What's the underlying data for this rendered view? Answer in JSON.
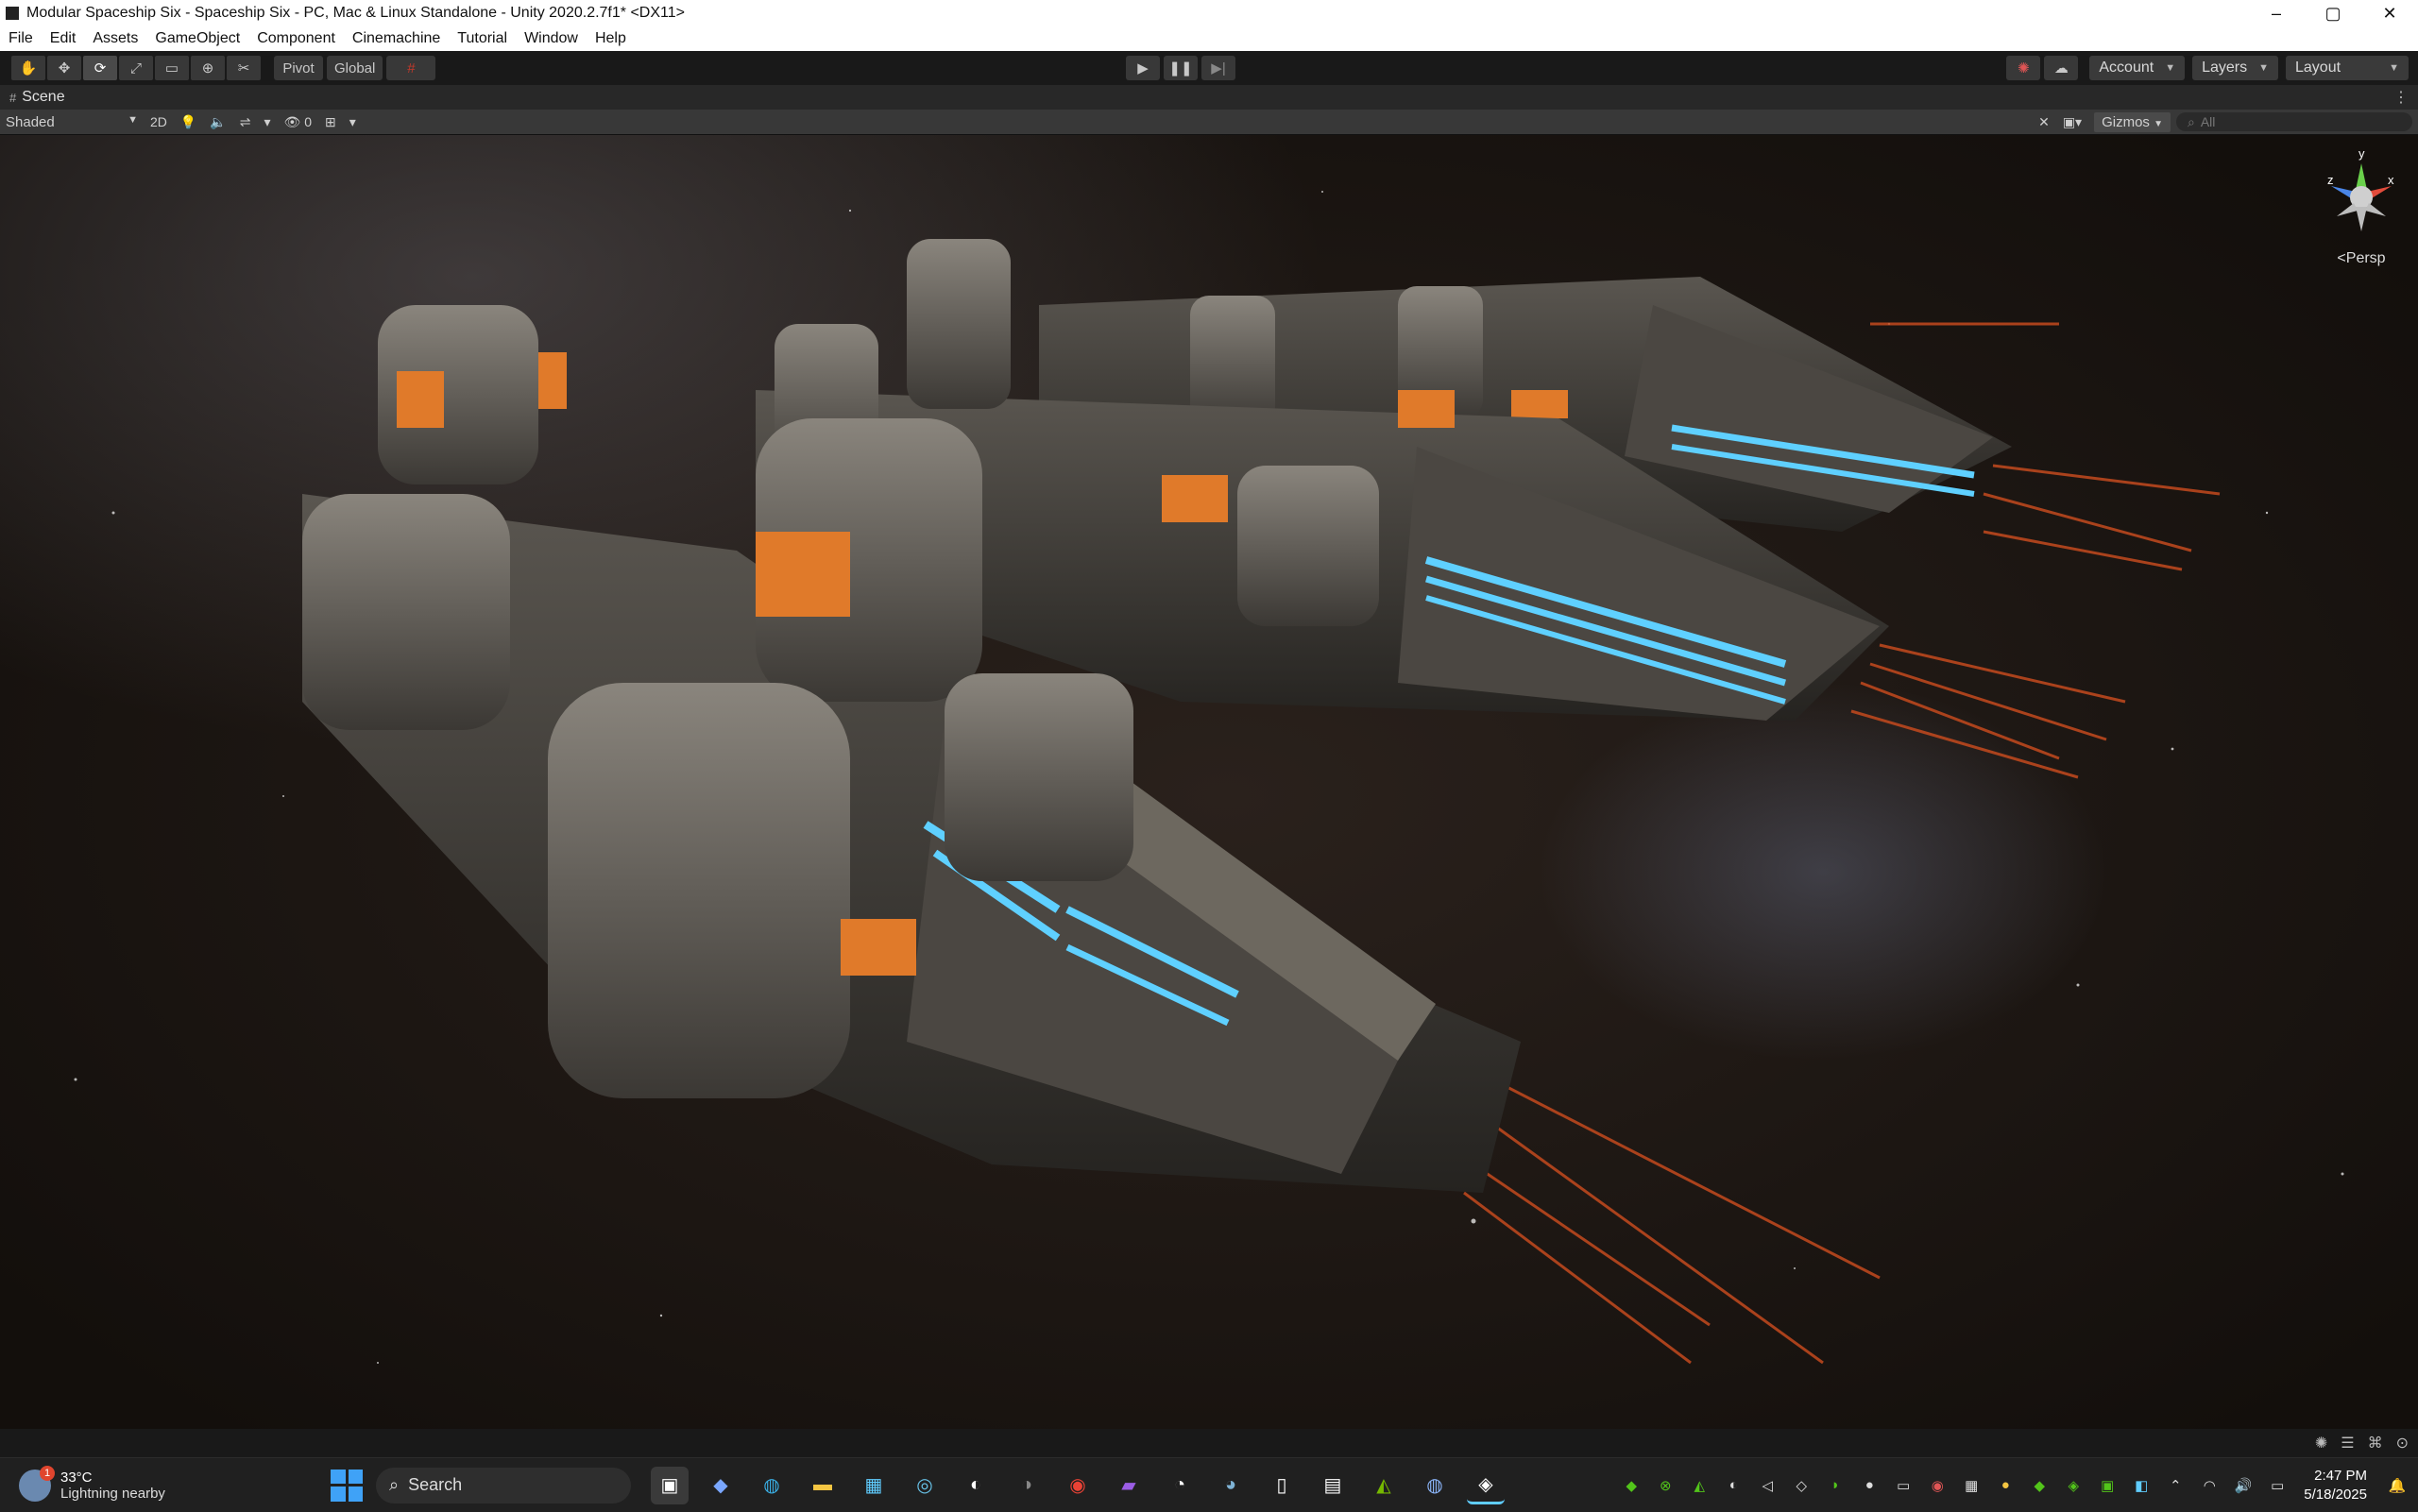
{
  "window": {
    "title": "Modular Spaceship Six - Spaceship Six - PC, Mac & Linux Standalone - Unity 2020.2.7f1* <DX11>",
    "controls": {
      "minimize": "–",
      "maximize": "▢",
      "close": "✕"
    }
  },
  "menu": [
    "File",
    "Edit",
    "Assets",
    "GameObject",
    "Component",
    "Cinemachine",
    "Tutorial",
    "Window",
    "Help"
  ],
  "toolbar": {
    "tools": [
      "✋",
      "✥",
      "⟳",
      "⤢",
      "▭",
      "⊕",
      "✂"
    ],
    "pivot_label": "Pivot",
    "global_label": "Global",
    "grid_icon": "#",
    "play": "▶",
    "pause": "❚❚",
    "step": "▶|",
    "collab_icon": "☁",
    "account_label": "Account",
    "layers_label": "Layers",
    "layout_label": "Layout"
  },
  "scene_tab": {
    "label": "Scene",
    "icon": "#",
    "menu": "⋮"
  },
  "scene_toolbar": {
    "draw_mode": "Shaded",
    "mode_2d": "2D",
    "hidden_count": "0",
    "gizmos_label": "Gizmos",
    "search_placeholder": "All"
  },
  "orientation_gizmo": {
    "y": "y",
    "z": "z",
    "x": "x",
    "projection": "<Persp"
  },
  "taskbar": {
    "weather_temp": "33°C",
    "weather_cond": "Lightning nearby",
    "weather_badge": "1",
    "search_label": "Search",
    "time": "2:47 PM",
    "date": "5/18/2025"
  },
  "colors": {
    "accent_blue": "#5fd0ff",
    "engine_orange": "#e07a2a",
    "hull_grey": "#5e5a54"
  }
}
